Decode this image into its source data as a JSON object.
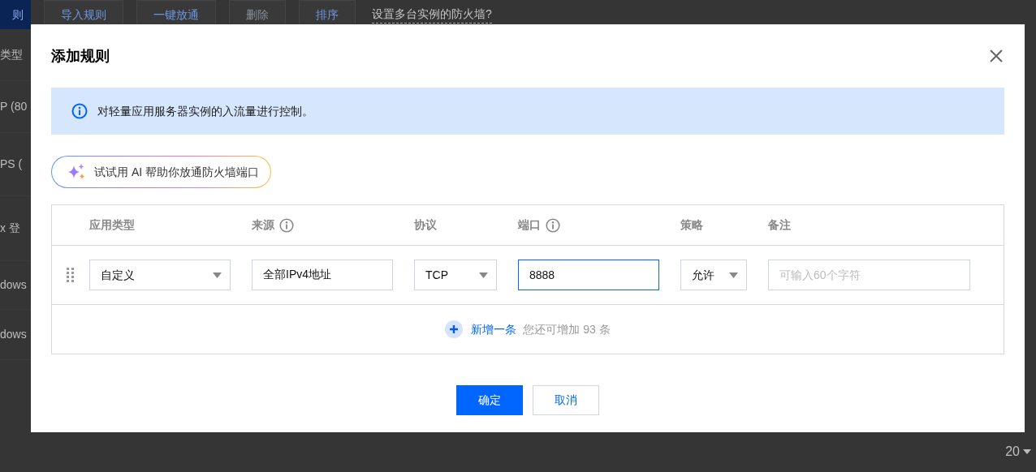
{
  "background": {
    "toolbar": [
      {
        "label": "则",
        "kind": "primary",
        "disabled": false
      },
      {
        "label": "导入规则",
        "kind": "default",
        "disabled": false
      },
      {
        "label": "一键放通",
        "kind": "default",
        "disabled": false
      },
      {
        "label": "删除",
        "kind": "default",
        "disabled": true
      },
      {
        "label": "排序",
        "kind": "default",
        "disabled": false
      }
    ],
    "help_link": "设置多台实例的防火墙?",
    "table": {
      "column_1": "类型",
      "rows": [
        "P (80",
        "PS (",
        "x 登",
        "dows",
        "dows"
      ]
    },
    "pagination": {
      "page_size": "20"
    }
  },
  "dialog": {
    "title": "添加规则",
    "notice": "对轻量应用服务器实例的入流量进行控制。",
    "ai_button": "试试用 AI 帮助你放通防火墙端口",
    "columns": [
      {
        "label": "应用类型",
        "info": false
      },
      {
        "label": "来源",
        "info": true
      },
      {
        "label": "协议",
        "info": false
      },
      {
        "label": "端口",
        "info": true
      },
      {
        "label": "策略",
        "info": false
      },
      {
        "label": "备注",
        "info": false
      }
    ],
    "rules": [
      {
        "cells": [
          {
            "kind": "select",
            "value": "自定义",
            "focused": false
          },
          {
            "kind": "input",
            "value": "全部IPv4地址",
            "focused": false
          },
          {
            "kind": "select",
            "value": "TCP",
            "focused": false
          },
          {
            "kind": "input",
            "value": "8888",
            "focused": true
          },
          {
            "kind": "select",
            "value": "允许",
            "focused": false
          },
          {
            "kind": "input",
            "placeholder": "可输入60个字符",
            "focused": false
          }
        ]
      }
    ],
    "add_link": "新增一条",
    "add_hint": "您还可增加 93 条",
    "buttons": [
      {
        "label": "确定",
        "kind": "primary"
      },
      {
        "label": "取消",
        "kind": "secondary"
      }
    ]
  }
}
